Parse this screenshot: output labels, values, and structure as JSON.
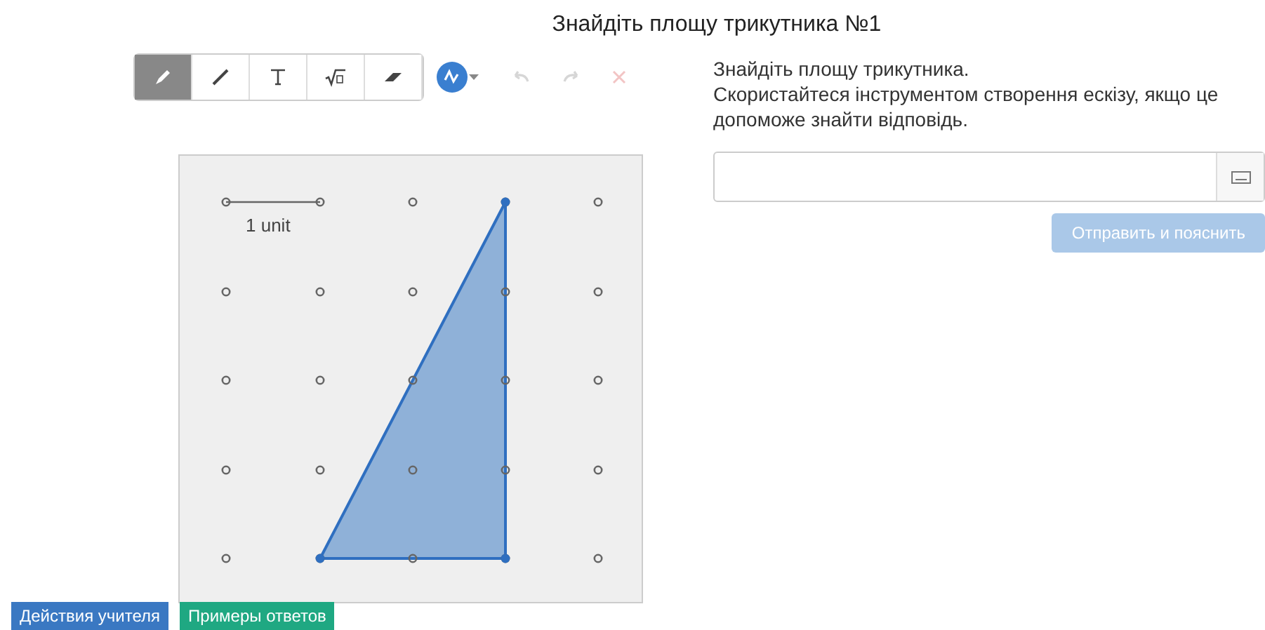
{
  "title": "Знайдіть площу трикутника №1",
  "toolbar": {
    "tools": [
      {
        "kind": "pencil",
        "selected": true
      },
      {
        "kind": "line",
        "selected": false
      },
      {
        "kind": "text",
        "selected": false
      },
      {
        "kind": "math",
        "selected": false
      },
      {
        "kind": "eraser",
        "selected": false
      }
    ],
    "actions": [
      {
        "kind": "undo",
        "disabled": true
      },
      {
        "kind": "redo",
        "disabled": true
      },
      {
        "kind": "clear",
        "disabled": true
      }
    ]
  },
  "canvas": {
    "scale_label": "1 unit"
  },
  "prompt": [
    "Знайдіть площу трикутника.",
    "Скористайтеся інструментом створення ескізу, якщо це допоможе знайти відповідь."
  ],
  "answer": {
    "submit": {
      "label": "Отправить и пояснить",
      "disabled": true
    }
  },
  "footer_buttons": [
    {
      "label": "Действия учителя",
      "color": "#3a78c2"
    },
    {
      "label": "Примеры ответов",
      "color": "#1fa882"
    }
  ]
}
